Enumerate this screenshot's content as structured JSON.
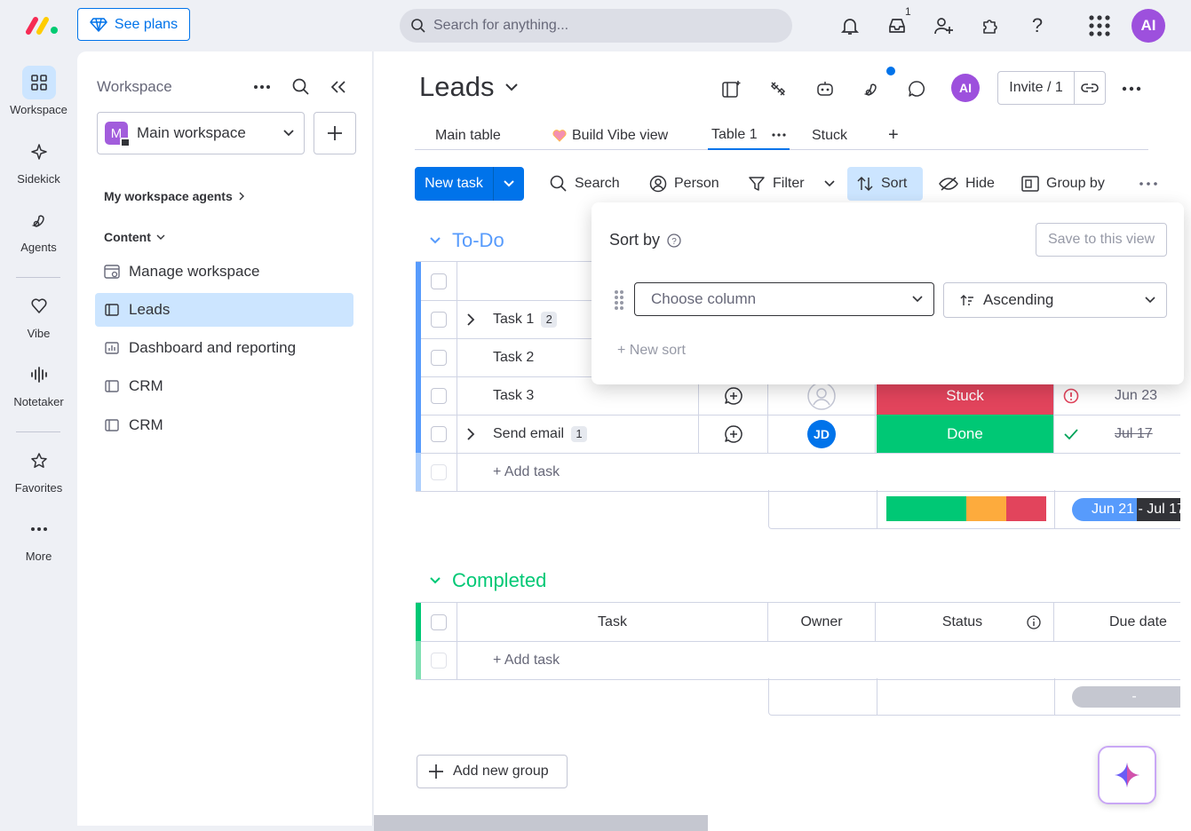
{
  "topbar": {
    "see_plans": "See plans",
    "search_placeholder": "Search for anything...",
    "inbox_count": "1",
    "user_initials": "AI"
  },
  "rail": {
    "items": [
      {
        "label": "Workspace",
        "icon": "grid-icon"
      },
      {
        "label": "Sidekick",
        "icon": "sparkle-icon"
      },
      {
        "label": "Agents",
        "icon": "agents-icon"
      },
      {
        "label": "Vibe",
        "icon": "heart-icon"
      },
      {
        "label": "Notetaker",
        "icon": "waveform-icon"
      },
      {
        "label": "Favorites",
        "icon": "star-icon"
      },
      {
        "label": "More",
        "icon": "dots-icon"
      }
    ]
  },
  "workspace": {
    "title": "Workspace",
    "selected": "Main workspace",
    "selected_initial": "M",
    "agents_link": "My workspace agents",
    "content_label": "Content",
    "items": [
      {
        "label": "Manage workspace",
        "icon": "manage-icon"
      },
      {
        "label": "Leads",
        "icon": "board-icon"
      },
      {
        "label": "Dashboard and reporting",
        "icon": "dashboard-icon"
      },
      {
        "label": "CRM",
        "icon": "board-icon"
      },
      {
        "label": "CRM",
        "icon": "board-icon"
      }
    ]
  },
  "board": {
    "title": "Leads",
    "invite": "Invite / 1",
    "user_initials": "AI",
    "tabs": [
      "Main table",
      "Build Vibe view",
      "Table 1",
      "Stuck",
      "+"
    ],
    "toolbar": {
      "new_task": "New task",
      "search": "Search",
      "person": "Person",
      "filter": "Filter",
      "sort": "Sort",
      "hide": "Hide",
      "group_by": "Group by"
    }
  },
  "sort_popover": {
    "title": "Sort by",
    "save_view": "Save to this view",
    "column_placeholder": "Choose column",
    "direction": "Ascending",
    "new_sort": "+ New sort"
  },
  "groups": [
    {
      "title": "To-Do",
      "color": "#579bfc",
      "rows": [
        {
          "task": "Task 1",
          "subitems": "2"
        },
        {
          "task": "Task 2"
        },
        {
          "task": "Task 3",
          "status": "Stuck",
          "status_color": "#e2445c",
          "due": "Jun 23"
        },
        {
          "task": "Send email",
          "subitems": "1",
          "owner": "JD",
          "status": "Done",
          "status_color": "#00c875",
          "due": "Jul 17"
        }
      ],
      "add_task": "+ Add task",
      "summary_timeline": "Jun 21 - Jul 17",
      "summary_status": [
        {
          "color": "#00c875",
          "fraction": 0.5
        },
        {
          "color": "#fdab3d",
          "fraction": 0.25
        },
        {
          "color": "#e2445c",
          "fraction": 0.25
        }
      ]
    },
    {
      "title": "Completed",
      "color": "#00c875",
      "columns": [
        "Task",
        "Owner",
        "Status",
        "Due date"
      ],
      "add_task": "+ Add task",
      "summary_timeline": "-"
    }
  ],
  "add_group": "Add new group"
}
